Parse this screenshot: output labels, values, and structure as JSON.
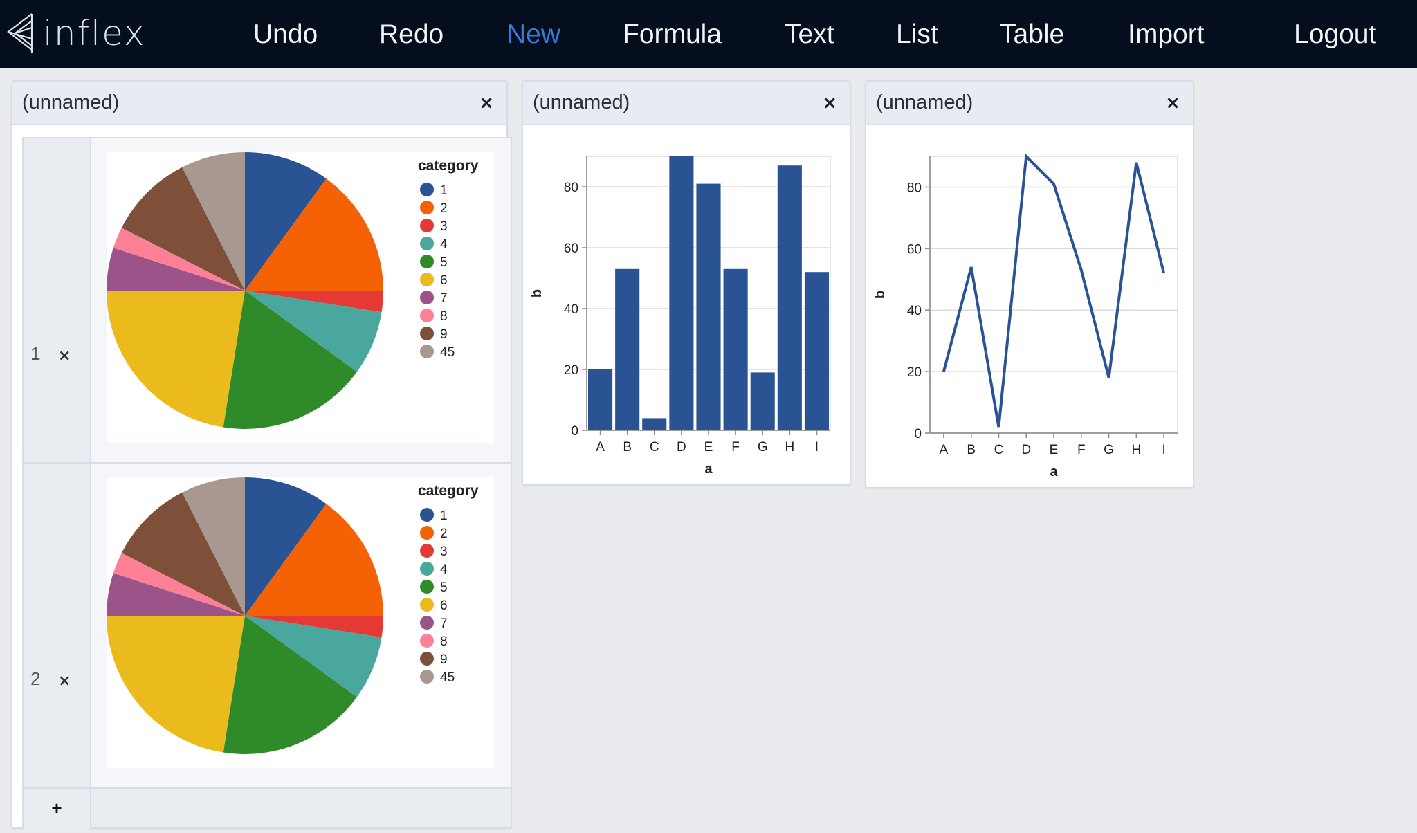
{
  "app": {
    "logo_text": "inflex"
  },
  "nav": {
    "items": [
      {
        "label": "Undo",
        "active": false
      },
      {
        "label": "Redo",
        "active": false
      },
      {
        "label": "New",
        "active": true
      },
      {
        "label": "Formula",
        "active": false
      },
      {
        "label": "Text",
        "active": false
      },
      {
        "label": "List",
        "active": false
      },
      {
        "label": "Table",
        "active": false
      },
      {
        "label": "Import",
        "active": false
      },
      {
        "label": "Logout",
        "active": false
      }
    ]
  },
  "cells": [
    {
      "title": "(unnamed)",
      "close_label": "×",
      "list": {
        "rows": [
          {
            "index": "1",
            "remove_label": "×"
          },
          {
            "index": "2",
            "remove_label": "×"
          }
        ],
        "add_label": "+"
      }
    },
    {
      "title": "(unnamed)",
      "close_label": "×"
    },
    {
      "title": "(unnamed)",
      "close_label": "×"
    }
  ],
  "colors": {
    "accent_blue": "#3a78d8",
    "series_blue": "#2a5393"
  },
  "chart_data": [
    {
      "type": "pie",
      "legend_title": "category",
      "legend_position": "top-right",
      "categories": [
        "1",
        "2",
        "3",
        "4",
        "5",
        "6",
        "7",
        "8",
        "9",
        "45"
      ],
      "values": [
        20,
        30,
        5,
        15,
        35,
        45,
        10,
        5,
        20,
        15
      ],
      "colors": [
        "#2a5393",
        "#f46205",
        "#e53935",
        "#4aa79d",
        "#2f8b29",
        "#ebbb1e",
        "#9c5389",
        "#fd8196",
        "#7f5039",
        "#a89890"
      ]
    },
    {
      "type": "pie",
      "legend_title": "category",
      "legend_position": "top-right",
      "categories": [
        "1",
        "2",
        "3",
        "4",
        "5",
        "6",
        "7",
        "8",
        "9",
        "45"
      ],
      "values": [
        20,
        30,
        5,
        15,
        35,
        45,
        10,
        5,
        20,
        15
      ],
      "colors": [
        "#2a5393",
        "#f46205",
        "#e53935",
        "#4aa79d",
        "#2f8b29",
        "#ebbb1e",
        "#9c5389",
        "#fd8196",
        "#7f5039",
        "#a89890"
      ]
    },
    {
      "type": "bar",
      "categories": [
        "A",
        "B",
        "C",
        "D",
        "E",
        "F",
        "G",
        "H",
        "I"
      ],
      "values": [
        20,
        53,
        4,
        90,
        81,
        53,
        19,
        87,
        52
      ],
      "xlabel": "a",
      "ylabel": "b",
      "ylim": [
        0,
        90
      ],
      "yticks": [
        0,
        20,
        40,
        60,
        80
      ],
      "grid": true,
      "color": "#2a5393"
    },
    {
      "type": "line",
      "categories": [
        "A",
        "B",
        "C",
        "D",
        "E",
        "F",
        "G",
        "H",
        "I"
      ],
      "values": [
        20,
        54,
        2,
        90,
        81,
        53,
        18,
        88,
        52
      ],
      "xlabel": "a",
      "ylabel": "b",
      "ylim": [
        0,
        90
      ],
      "yticks": [
        0,
        20,
        40,
        60,
        80
      ],
      "grid": true,
      "color": "#2a5393"
    }
  ]
}
